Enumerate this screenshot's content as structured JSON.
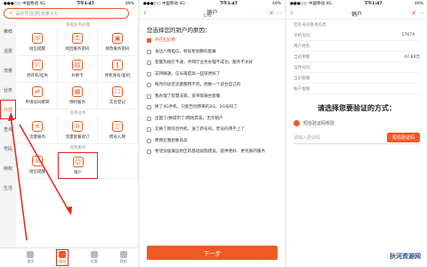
{
  "panel1": {
    "status": {
      "left": "●●●○○ 中国移动 4G",
      "time": "下午1:47",
      "right": "49%"
    },
    "search_placeholder": "请好号|花费|流量大礼",
    "sidebar": [
      {
        "label": "推荐"
      },
      {
        "label": "话费"
      },
      {
        "label": "流量"
      },
      {
        "label": "业务"
      },
      {
        "label": "办理"
      },
      {
        "label": "查询"
      },
      {
        "label": "号码"
      },
      {
        "label": "特权"
      },
      {
        "label": "生活"
      }
    ],
    "sections": [
      {
        "title": "基础业务办理",
        "items": [
          "短信提醒",
          "找回服务密码",
          "修改服务密码",
          "停开机/挂失",
          "补换卡",
          "停机保号/复机",
          "申请号码携转",
          "预约服务",
          "实名登记"
        ]
      },
      {
        "title": "宽带业务",
        "items": [
          "流量服务",
          "流量套餐退订",
          "携号入网"
        ]
      },
      {
        "title": "其他服务",
        "items": [
          "短信提醒",
          "销户"
        ]
      }
    ],
    "tabs": [
      "首页",
      "服务",
      "优惠",
      "我的"
    ]
  },
  "panel2": {
    "status": {
      "left": "●●●○○ 中国移动 4G",
      "time": "下午1:47",
      "right": "49%"
    },
    "title": "销户",
    "subtitle": "176        ",
    "prompt": "您选择您的销户的原因：",
    "reasons": [
      {
        "label": "存在乱扣费",
        "selected": true
      },
      {
        "label": "身边人用电信，移动更划算的套餐",
        "selected": false
      },
      {
        "label": "客服热线打不通，手网厅业务办理不成功，服务不太好",
        "selected": false
      },
      {
        "label": "支持联通，信号再提高一些就更好了",
        "selected": false
      },
      {
        "label": "每月的语音流量都用不完，想换一个适合自己的",
        "selected": false
      },
      {
        "label": "我办理了智慧沃家，宽带等融合套餐",
        "selected": false
      },
      {
        "label": "换了4G手机，只能告别原来的2G、3G号码了",
        "selected": false
      },
      {
        "label": "出国了/换城市了/两地奔波，无奈销户",
        "selected": false
      },
      {
        "label": "又换了新的合约机，送了新号码，老号码用不上了",
        "selected": false
      },
      {
        "label": "费用比我想象的高",
        "selected": false
      },
      {
        "label": "希望加强偏远地区的基础设施建设，提供更好、更优质的服务",
        "selected": false
      }
    ],
    "next_button": "下一步"
  },
  "panel3": {
    "status": {
      "left": "●●●○○ 中国移动 4G",
      "time": "下午1:47",
      "right": "49%"
    },
    "title": "销户",
    "info_header": "您的号码基本信息",
    "info": [
      {
        "k": "手机号码",
        "v": "17674    "
      },
      {
        "k": "用户姓名",
        "v": "     "
      },
      {
        "k": "当前余额",
        "v": "47.84元"
      },
      {
        "k": "证件号码",
        "v": "     "
      },
      {
        "k": "当前套餐",
        "v": "     "
      },
      {
        "k": "账户金额",
        "v": "     "
      }
    ],
    "verify_title": "请选择您要验证的方式：",
    "verify_option": "短信验证码校验",
    "code_placeholder": "请输入验证码",
    "get_code_button": "短信验证码",
    "watermark": "狄河资源网"
  }
}
